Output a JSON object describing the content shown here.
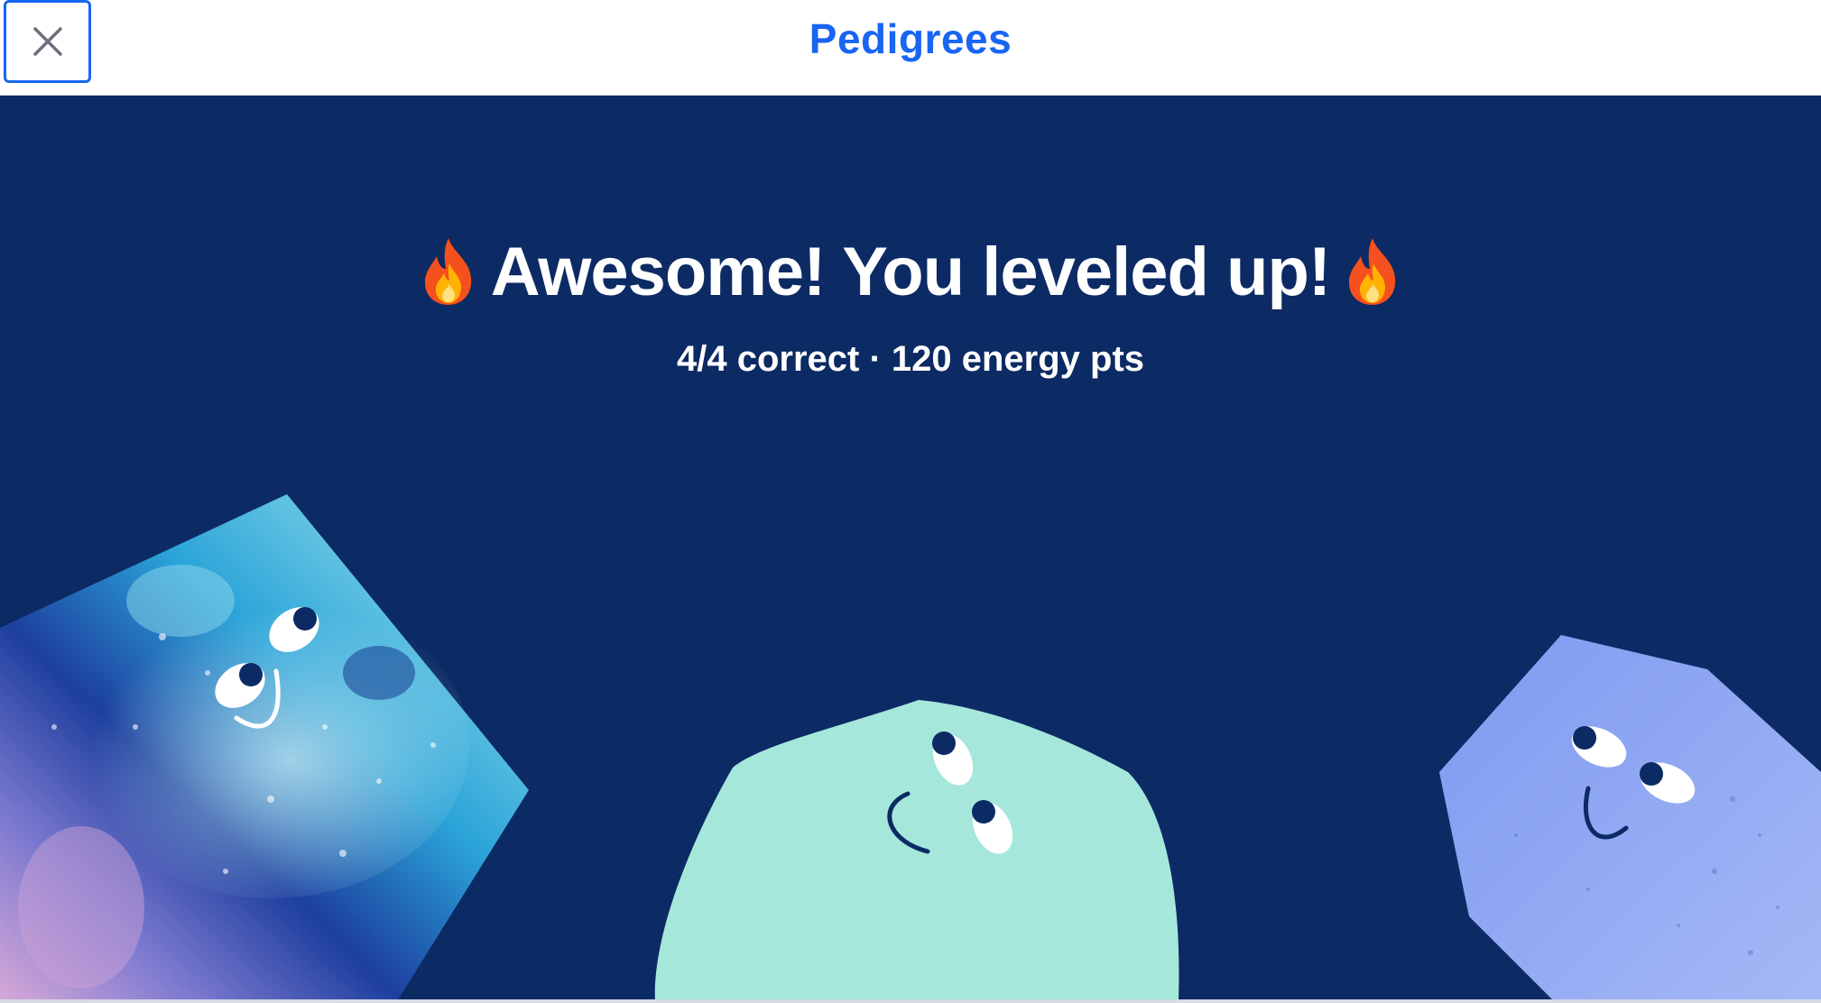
{
  "header": {
    "title": "Pedigrees",
    "close_icon": "close-icon"
  },
  "result": {
    "headline": "Awesome! You leveled up!",
    "headline_icon": "fire-emoji",
    "summary": "4/4 correct · 120 energy pts"
  },
  "colors": {
    "accent": "#1865f2",
    "stage_background": "#0c2a64",
    "mint_character": "#a6e7dc",
    "periwinkle_character": "#8aa6f2",
    "galaxy_character": "#2f8fd6"
  }
}
